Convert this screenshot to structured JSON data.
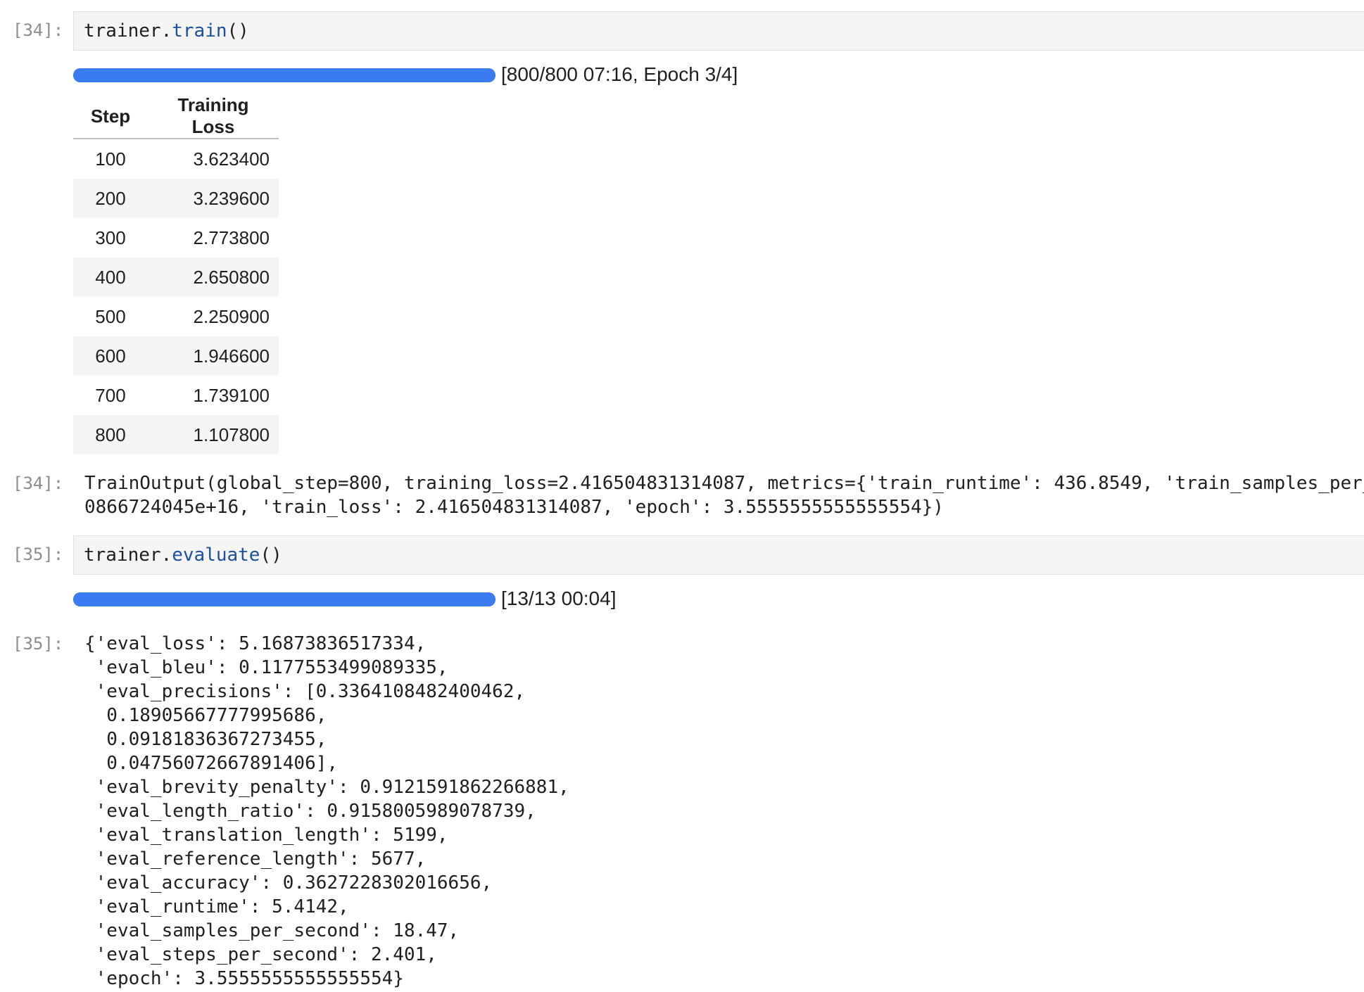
{
  "cells": {
    "train": {
      "in_prompt": "[34]:",
      "code_obj": "trainer.",
      "code_fn": "train",
      "code_paren": "()",
      "progress_percent": 100,
      "progress_label": "[800/800 07:16, Epoch 3/4]",
      "table": {
        "headers": [
          "Step",
          "Training Loss"
        ],
        "rows": [
          {
            "step": "100",
            "loss": "3.623400"
          },
          {
            "step": "200",
            "loss": "3.239600"
          },
          {
            "step": "300",
            "loss": "2.773800"
          },
          {
            "step": "400",
            "loss": "2.650800"
          },
          {
            "step": "500",
            "loss": "2.250900"
          },
          {
            "step": "600",
            "loss": "1.946600"
          },
          {
            "step": "700",
            "loss": "1.739100"
          },
          {
            "step": "800",
            "loss": "1.107800"
          }
        ]
      },
      "out_prompt": "[34]:",
      "output_lines": [
        "TrainOutput(global_step=800, training_loss=2.416504831314087, metrics={'train_runtime': 436.8549, 'train_samples_per_",
        "0866724045e+16, 'train_loss': 2.416504831314087, 'epoch': 3.5555555555555554})"
      ]
    },
    "evaluate": {
      "in_prompt": "[35]:",
      "code_obj": "trainer.",
      "code_fn": "evaluate",
      "code_paren": "()",
      "progress_percent": 100,
      "progress_label": "[13/13 00:04]",
      "out_prompt": "[35]:",
      "output_lines": [
        "{'eval_loss': 5.16873836517334,",
        " 'eval_bleu': 0.1177553499089335,",
        " 'eval_precisions': [0.3364108482400462,",
        "  0.18905667777995686,",
        "  0.09181836367273455,",
        "  0.04756072667891406],",
        " 'eval_brevity_penalty': 0.9121591862266881,",
        " 'eval_length_ratio': 0.9158005989078739,",
        " 'eval_translation_length': 5199,",
        " 'eval_reference_length': 5677,",
        " 'eval_accuracy': 0.3627228302016656,",
        " 'eval_runtime': 5.4142,",
        " 'eval_samples_per_second': 18.47,",
        " 'eval_steps_per_second': 2.401,",
        " 'epoch': 3.5555555555555554}"
      ]
    }
  },
  "colors": {
    "progress": "#3a7cf0",
    "function_name": "#1c4fa0",
    "prompt": "#8c8c8c",
    "cell_background": "#f5f5f5"
  }
}
